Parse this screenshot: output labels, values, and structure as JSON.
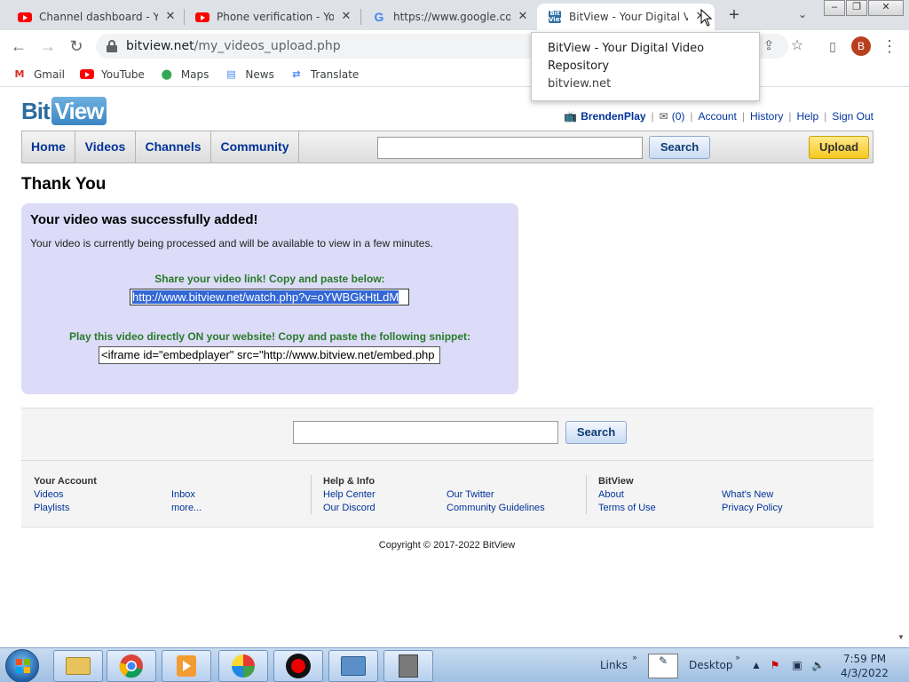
{
  "browser": {
    "tabs": [
      {
        "title": "Channel dashboard - YouTube",
        "favicon": "youtube-icon"
      },
      {
        "title": "Phone verification - YouTube",
        "favicon": "youtube-icon"
      },
      {
        "title": "https://www.google.com/",
        "favicon": "google-icon"
      },
      {
        "title": "BitView - Your Digital Video Repository",
        "favicon": "bitview-icon",
        "active": true
      }
    ],
    "url_host": "bitview.net",
    "url_path": "/my_videos_upload.php",
    "profile_initial": "B",
    "bookmarks": [
      {
        "label": "Gmail",
        "icon": "gmail-icon"
      },
      {
        "label": "YouTube",
        "icon": "youtube-icon"
      },
      {
        "label": "Maps",
        "icon": "maps-icon"
      },
      {
        "label": "News",
        "icon": "news-icon"
      },
      {
        "label": "Translate",
        "icon": "translate-icon"
      }
    ],
    "hovercard": {
      "title": "BitView - Your Digital Video Repository",
      "domain": "bitview.net"
    }
  },
  "site": {
    "logo_part1": "Bit",
    "logo_part2": "View",
    "user": {
      "username": "BrendenPlay",
      "inbox_count": "(0)",
      "links": [
        "Account",
        "History",
        "Help",
        "Sign Out"
      ]
    },
    "nav": [
      "Home",
      "Videos",
      "Channels",
      "Community"
    ],
    "search_button": "Search",
    "upload_button": "Upload"
  },
  "main": {
    "heading": "Thank You",
    "success_title": "Your video was successfully added!",
    "success_message": "Your video is currently being processed and will be available to view in a few minutes.",
    "share_label": "Share your video link! Copy and paste below:",
    "share_link": "http://www.bitview.net/watch.php?v=oYWBGkHtLdM",
    "embed_label": "Play this video directly ON your website! Copy and paste the following snippet:",
    "embed_code": "<iframe id=\"embedplayer\" src=\"http://www.bitview.net/embed.php"
  },
  "footer": {
    "search_button": "Search",
    "your_account": {
      "heading": "Your Account",
      "links": [
        "Videos",
        "Playlists",
        "Inbox",
        "more..."
      ]
    },
    "help_info": {
      "heading": "Help & Info",
      "links": [
        "Help Center",
        "Our Discord",
        "Our Twitter",
        "Community Guidelines"
      ]
    },
    "bitview": {
      "heading": "BitView",
      "links": [
        "About",
        "Terms of Use",
        "What's New",
        "Privacy Policy"
      ]
    },
    "copyright": "Copyright © 2017-2022 BitView"
  },
  "taskbar": {
    "links_label": "Links",
    "desktop_label": "Desktop",
    "time": "7:59 PM",
    "date": "4/3/2022"
  },
  "colors": {
    "link_blue": "#003399",
    "success_bg": "#dcdcf8",
    "green_label": "#2a7a2a",
    "upload_yellow": "#f7c81f"
  }
}
